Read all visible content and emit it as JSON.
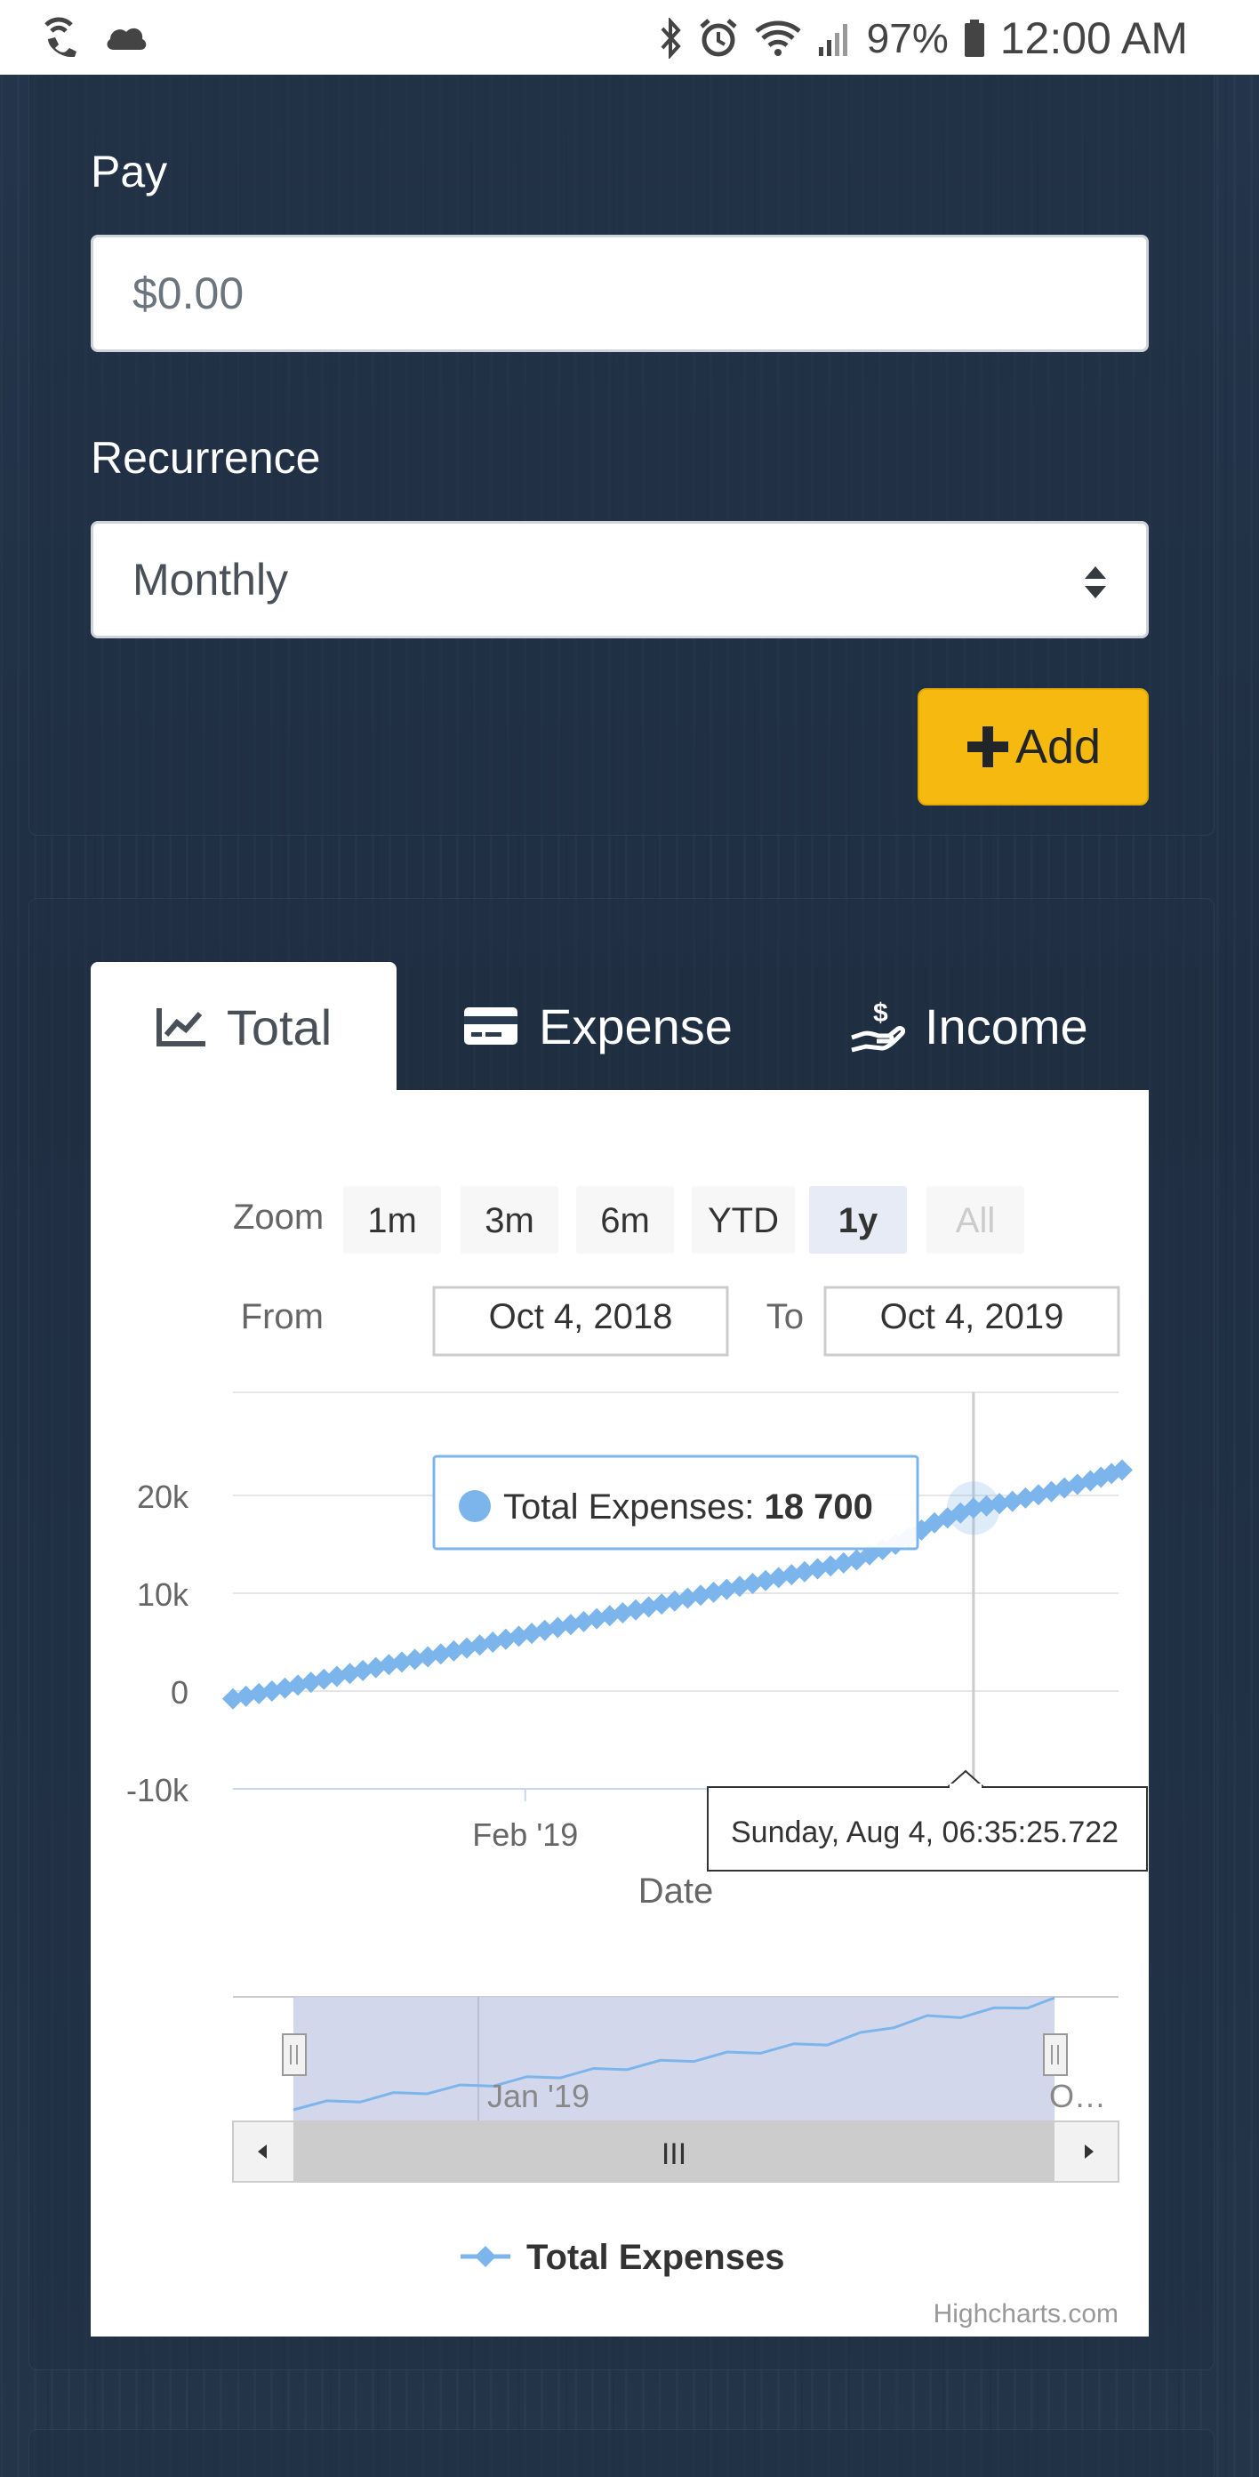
{
  "status_bar": {
    "battery": "97%",
    "time": "12:00 AM",
    "icons": [
      "wifi-call-icon",
      "cloud-icon",
      "bluetooth-icon",
      "alarm-icon",
      "wifi-icon",
      "signal-icon",
      "battery-icon"
    ]
  },
  "form": {
    "pay_label": "Pay",
    "pay_placeholder": "$0.00",
    "recurrence_label": "Recurrence",
    "recurrence_value": "Monthly",
    "add_button": "Add"
  },
  "tabs": [
    {
      "label": "Total",
      "icon": "chart-area-icon",
      "active": true
    },
    {
      "label": "Expense",
      "icon": "credit-card-icon",
      "active": false
    },
    {
      "label": "Income",
      "icon": "hand-dollar-icon",
      "active": false
    }
  ],
  "chart": {
    "zoom_label": "Zoom",
    "zoom_buttons": [
      "1m",
      "3m",
      "6m",
      "YTD",
      "1y",
      "All"
    ],
    "zoom_selected": "1y",
    "from_label": "From",
    "from_value": "Oct 4, 2018",
    "to_label": "To",
    "to_value": "Oct 4, 2019",
    "tooltip_series": "Total Expenses: ",
    "tooltip_value": "18 700",
    "crosshair_label": "Sunday, Aug 4, 06:35:25.722",
    "navigator_label": "Jan '19",
    "navigator_right_label": "O…",
    "scrollbar_grip": "III",
    "credits": "Highcharts.com",
    "colors": {
      "series": "#7cb5ec",
      "selected_zoom": "#e6ebf5",
      "navigator_mask": "#cdd3ea"
    }
  },
  "chart_data": {
    "type": "line",
    "xlabel": "Date",
    "ylabel": "",
    "x_tick_labels": [
      "Feb '19"
    ],
    "y_tick_labels": [
      "20k",
      "10k",
      "0",
      "-10k"
    ],
    "ylim": [
      -10000,
      30000
    ],
    "legend": [
      "Total Expenses"
    ],
    "legend_position": "bottom",
    "series": [
      {
        "name": "Total Expenses",
        "x": [
          "2018-10-04",
          "2018-10-20",
          "2018-11-05",
          "2018-11-21",
          "2018-12-07",
          "2018-12-23",
          "2019-01-08",
          "2019-01-24",
          "2019-02-09",
          "2019-02-25",
          "2019-03-13",
          "2019-03-29",
          "2019-04-14",
          "2019-04-30",
          "2019-05-16",
          "2019-06-01",
          "2019-06-17",
          "2019-07-03",
          "2019-07-19",
          "2019-08-04",
          "2019-08-20",
          "2019-09-05",
          "2019-09-21",
          "2019-10-04"
        ],
        "values": [
          -800,
          0,
          900,
          1800,
          2700,
          3500,
          4400,
          5300,
          6200,
          7100,
          8000,
          8900,
          9800,
          10700,
          11600,
          12500,
          13400,
          15000,
          17200,
          18700,
          19400,
          20400,
          21500,
          22600
        ]
      }
    ]
  }
}
